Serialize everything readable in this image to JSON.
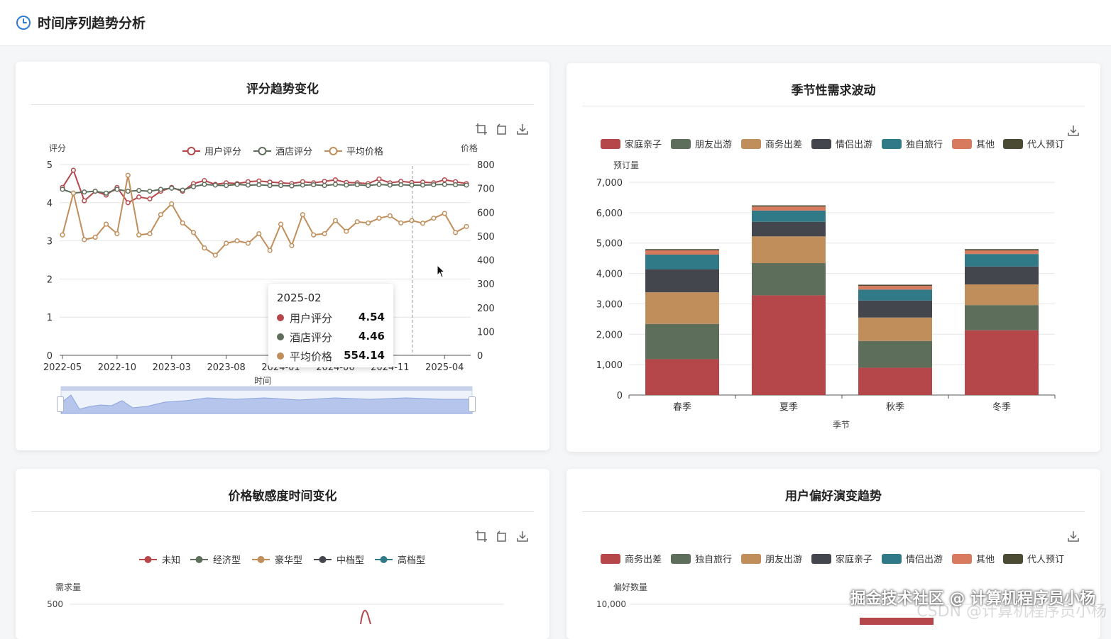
{
  "header": {
    "title": "时间序列趋势分析",
    "icon": "clock-icon",
    "accent": "#2f7bd6"
  },
  "cards": {
    "rating": {
      "title": "评分趋势变化",
      "left_axis_label": "评分",
      "right_axis_label": "价格",
      "x_axis_label": "时间",
      "x_ticks": [
        "2022-05",
        "2022-10",
        "2023-03",
        "2023-08",
        "2024-01",
        "2024-06",
        "2024-11",
        "2025-04"
      ],
      "tooltip": {
        "title": "2025-02",
        "rows": [
          {
            "label": "用户评分",
            "value": "4.54",
            "color": "#b5474b"
          },
          {
            "label": "酒店评分",
            "value": "4.46",
            "color": "#5d6e5a"
          },
          {
            "label": "平均价格",
            "value": "554.14",
            "color": "#c08e5a"
          }
        ]
      }
    },
    "seasonal": {
      "title": "季节性需求波动"
    },
    "price": {
      "title": "价格敏感度时间变化",
      "y_axis_label": "需求量",
      "y_top_tick": "500",
      "legend": [
        {
          "label": "未知",
          "color": "#b5474b"
        },
        {
          "label": "经济型",
          "color": "#5d6e5a"
        },
        {
          "label": "豪华型",
          "color": "#c08e5a"
        },
        {
          "label": "中档型",
          "color": "#43464d"
        },
        {
          "label": "高档型",
          "color": "#2f7a86"
        }
      ]
    },
    "preference": {
      "title": "用户偏好演变趋势",
      "y_axis_label": "偏好数量",
      "y_top_tick": "10,000",
      "legend": [
        {
          "label": "商务出差",
          "color": "#b5474b"
        },
        {
          "label": "独自旅行",
          "color": "#5d6e5a"
        },
        {
          "label": "朋友出游",
          "color": "#c08e5a"
        },
        {
          "label": "家庭亲子",
          "color": "#43464d"
        },
        {
          "label": "情侣出游",
          "color": "#2f7a86"
        },
        {
          "label": "其他",
          "color": "#d77a5e"
        },
        {
          "label": "代人预订",
          "color": "#4b4a33"
        }
      ]
    }
  },
  "watermark": "掘金技术社区 @ 计算机程序员小杨",
  "watermark_faint": "CSDN @计算机程序员小杨",
  "chart_data": [
    {
      "type": "line",
      "title": "评分趋势变化",
      "xlabel": "时间",
      "ylabel": "评分",
      "y2label": "价格",
      "ylim": [
        0,
        5
      ],
      "y2lim": [
        0,
        800
      ],
      "y_ticks": [
        "0",
        "1",
        "2",
        "3",
        "4",
        "5"
      ],
      "y2_ticks": [
        "0",
        "100",
        "200",
        "300",
        "400",
        "500",
        "600",
        "700",
        "800"
      ],
      "x": [
        "2022-05",
        "2022-06",
        "2022-07",
        "2022-08",
        "2022-09",
        "2022-10",
        "2022-11",
        "2022-12",
        "2023-01",
        "2023-02",
        "2023-03",
        "2023-04",
        "2023-05",
        "2023-06",
        "2023-07",
        "2023-08",
        "2023-09",
        "2023-10",
        "2023-11",
        "2023-12",
        "2024-01",
        "2024-02",
        "2024-03",
        "2024-04",
        "2024-05",
        "2024-06",
        "2024-07",
        "2024-08",
        "2024-09",
        "2024-10",
        "2024-11",
        "2024-12",
        "2025-01",
        "2025-02",
        "2025-03",
        "2025-04",
        "2025-05",
        "2025-06"
      ],
      "series": [
        {
          "name": "用户评分",
          "axis": "left",
          "color": "#b5474b",
          "values": [
            4.4,
            4.85,
            4.05,
            4.3,
            4.2,
            4.4,
            4.0,
            4.15,
            4.1,
            4.3,
            4.4,
            4.3,
            4.5,
            4.58,
            4.48,
            4.52,
            4.5,
            4.55,
            4.57,
            4.54,
            4.52,
            4.5,
            4.55,
            4.52,
            4.56,
            4.6,
            4.53,
            4.52,
            4.5,
            4.62,
            4.52,
            4.56,
            4.53,
            4.54,
            4.52,
            4.6,
            4.55,
            4.5
          ]
        },
        {
          "name": "酒店评分",
          "axis": "left",
          "color": "#5d6e5a",
          "values": [
            4.35,
            4.25,
            4.28,
            4.3,
            4.25,
            4.35,
            4.3,
            4.32,
            4.3,
            4.35,
            4.38,
            4.33,
            4.42,
            4.48,
            4.46,
            4.45,
            4.48,
            4.46,
            4.47,
            4.45,
            4.45,
            4.44,
            4.46,
            4.47,
            4.45,
            4.48,
            4.46,
            4.47,
            4.45,
            4.48,
            4.46,
            4.47,
            4.46,
            4.46,
            4.47,
            4.48,
            4.47,
            4.46
          ]
        },
        {
          "name": "平均价格",
          "axis": "right",
          "color": "#c08e5a",
          "values": [
            505,
            680,
            485,
            495,
            550,
            510,
            755,
            505,
            510,
            590,
            635,
            555,
            515,
            450,
            420,
            470,
            480,
            470,
            510,
            440,
            550,
            460,
            590,
            505,
            510,
            565,
            520,
            560,
            555,
            575,
            585,
            555,
            565,
            554,
            575,
            595,
            515,
            540
          ]
        }
      ],
      "tooltip_x": "2025-02"
    },
    {
      "type": "bar",
      "stacked": true,
      "title": "季节性需求波动",
      "xlabel": "季节",
      "ylabel": "预订量",
      "ylim": [
        0,
        7000
      ],
      "y_ticks": [
        "0",
        "1,000",
        "2,000",
        "3,000",
        "4,000",
        "5,000",
        "6,000",
        "7,000"
      ],
      "categories": [
        "春季",
        "夏季",
        "秋季",
        "冬季"
      ],
      "series": [
        {
          "name": "家庭亲子",
          "color": "#b5474b",
          "values": [
            1180,
            3280,
            900,
            2130
          ]
        },
        {
          "name": "朋友出游",
          "color": "#5d6e5a",
          "values": [
            1160,
            1060,
            880,
            830
          ]
        },
        {
          "name": "商务出差",
          "color": "#c08e5a",
          "values": [
            1040,
            880,
            770,
            680
          ]
        },
        {
          "name": "情侣出游",
          "color": "#43464d",
          "values": [
            760,
            480,
            560,
            590
          ]
        },
        {
          "name": "独自旅行",
          "color": "#2f7a86",
          "values": [
            480,
            370,
            360,
            410
          ]
        },
        {
          "name": "其他",
          "color": "#d77a5e",
          "values": [
            140,
            130,
            120,
            120
          ]
        },
        {
          "name": "代人预订",
          "color": "#4b4a33",
          "values": [
            40,
            40,
            40,
            40
          ]
        }
      ]
    }
  ]
}
